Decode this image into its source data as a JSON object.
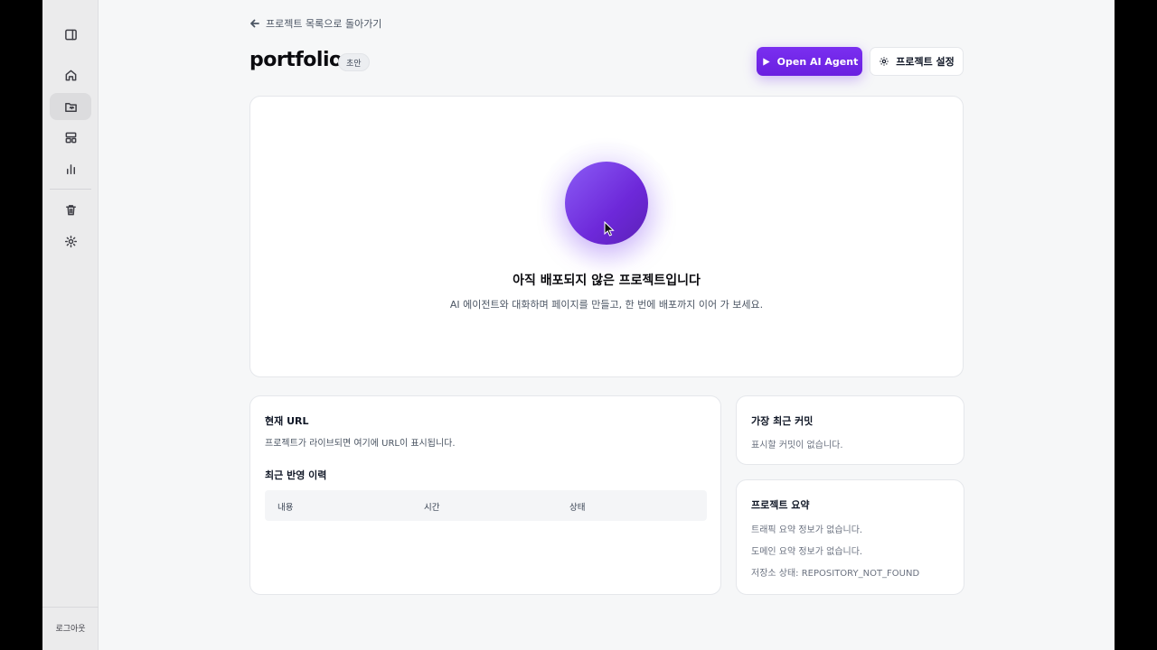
{
  "sidebar": {
    "items": [
      {
        "icon": "panel-toggle-icon"
      },
      {
        "icon": "home-icon"
      },
      {
        "icon": "folder-icon"
      },
      {
        "icon": "layout-icon"
      },
      {
        "icon": "chart-icon"
      },
      {
        "icon": "trash-icon"
      },
      {
        "icon": "gear-icon"
      }
    ],
    "logout_label": "로그아웃"
  },
  "header": {
    "back_label": "프로젝트 목록으로 돌아가기",
    "project_name": "portfolio",
    "status_badge": "초안",
    "agent_button": "Open AI Agent",
    "settings_button": "프로젝트 설정"
  },
  "hero": {
    "title": "아직 배포되지 않은 프로젝트입니다",
    "description": "AI 에이전트와 대화하며 페이지를 만들고, 한 번에 배포까지 이어 가 보세요."
  },
  "url_card": {
    "title": "현재 URL",
    "text": "프로젝트가 라이브되면 여기에 URL이 표시됩니다.",
    "history_title": "최근 반영 이력",
    "columns": [
      "내용",
      "시간",
      "상태"
    ]
  },
  "commit_card": {
    "title": "가장 최근 커밋",
    "text": "표시할 커밋이 없습니다."
  },
  "summary_card": {
    "title": "프로젝트 요약",
    "lines": [
      "트래픽 요약 정보가 없습니다.",
      "도메인 요약 정보가 없습니다.",
      "저장소 상태: REPOSITORY_NOT_FOUND"
    ]
  },
  "colors": {
    "accent": "#6d28d9",
    "background": "#f6f7f8",
    "sidebar": "#ebebec"
  }
}
